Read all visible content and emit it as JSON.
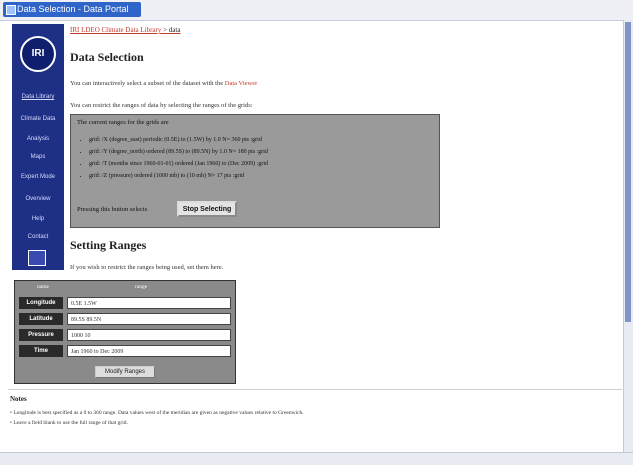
{
  "tab": {
    "title": "Data Selection - Data Portal"
  },
  "sidebar": {
    "logo": "IRI",
    "links": [
      "Data Library",
      "Climate Data",
      "Analysis",
      "Maps",
      "Expert Mode",
      "Overview",
      "Help",
      "Contact"
    ]
  },
  "breadcrumb": {
    "link": "IRI LDEO Climate Data Library",
    "suffix": "> data"
  },
  "data_selection": {
    "heading": "Data Selection",
    "para1": "You can interactively select a subset of the dataset with the",
    "para1_link": "Data Viewer",
    "para2": "You can restrict the ranges of data by selecting the ranges of the grids:",
    "box_header": "The current ranges for the grids are",
    "grids": [
      "grid: /X (degree_east) periodic (0.5E) to (1.5W) by 1.0 N= 360 pts :grid",
      "grid: /Y (degree_north) ordered (89.5S) to (89.5N) by 1.0 N= 180 pts :grid",
      "grid: /T (months since 1960-01-01) ordered (Jan 1960) to (Dec 2009) :grid",
      "grid: /Z (pressure) ordered (1000 mb) to (10 mb) N= 17 pts :grid"
    ],
    "box_footer": "Pressing this button selects",
    "stop_button": "Stop Selecting"
  },
  "setting_ranges": {
    "heading": "Setting Ranges",
    "para": "If you wish to restrict the ranges being used, set them here.",
    "col_name": "name",
    "col_range": "range",
    "rows": [
      {
        "name": "Longitude",
        "value": "0.5E 1.5W"
      },
      {
        "name": "Latitude",
        "value": "89.5S 89.5N"
      },
      {
        "name": "Pressure",
        "value": "1000 10"
      },
      {
        "name": "Time",
        "value": "Jan 1960 to Dec 2009"
      }
    ],
    "modify_button": "Modify Ranges"
  },
  "notes": {
    "heading": "Notes",
    "items": [
      "Longitude is best specified as a 0 to 360 range. Data values west of the meridian are given as negative values relative to Greenwich.",
      "Leave a field blank to use the full range of that grid."
    ]
  }
}
